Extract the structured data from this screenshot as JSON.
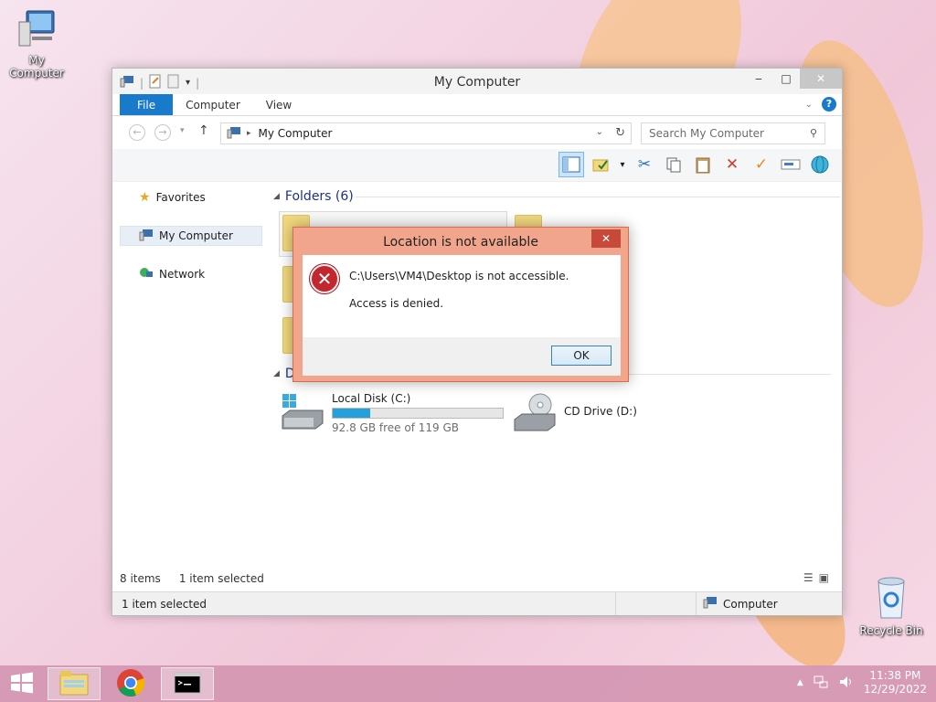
{
  "desktop": {
    "icons": [
      {
        "label": "My Computer",
        "icon": "computer-icon"
      },
      {
        "label": "Recycle Bin",
        "icon": "recycle-bin-icon"
      }
    ]
  },
  "window": {
    "title": "My Computer",
    "tabs": [
      "File",
      "Computer",
      "View"
    ],
    "address": "My Computer",
    "search_placeholder": "Search My Computer",
    "nav": {
      "favorites": "Favorites",
      "my_computer": "My Computer",
      "network": "Network"
    },
    "groups": {
      "folders": "Folders (6)",
      "devices_partial": "D"
    },
    "drives": [
      {
        "name": "Local Disk (C:)",
        "free": "92.8 GB free of 119 GB",
        "used_fraction": 0.22
      },
      {
        "name": "CD Drive (D:)"
      }
    ],
    "status": {
      "items": "8 items",
      "selected": "1 item selected",
      "details_selected": "1 item selected",
      "location": "Computer"
    }
  },
  "dialog": {
    "title": "Location is not available",
    "message": "C:\\Users\\VM4\\Desktop is not accessible.",
    "detail": "Access is denied.",
    "ok_label": "OK",
    "accent": "#f0a58c"
  },
  "taskbar": {
    "apps": [
      "file-explorer-icon",
      "chrome-icon",
      "command-prompt-icon"
    ],
    "time": "11:38 PM",
    "date": "12/29/2022"
  }
}
